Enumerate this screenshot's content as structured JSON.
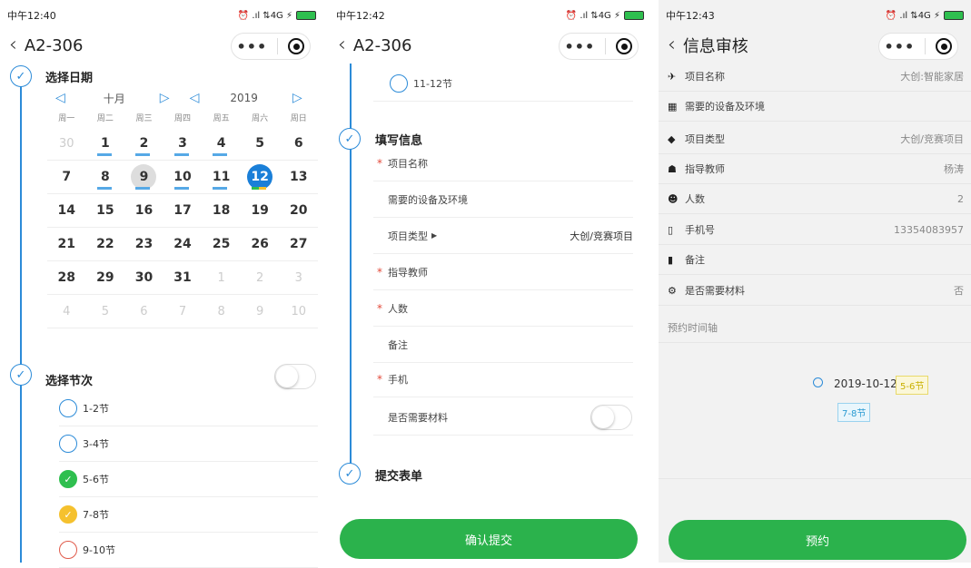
{
  "status": [
    {
      "time": "中午12:40",
      "right": "⏰ .ıl ⇅4G ⚡"
    },
    {
      "time": "中午12:42",
      "right": "⏰ .ıl ⇅4G ⚡"
    },
    {
      "time": "中午12:43",
      "right": "⏰ .ıl ⇅4G ⚡"
    }
  ],
  "screen1": {
    "title": "A2-306",
    "step_date": "选择日期",
    "month": "十月",
    "year": "2019",
    "weekdays": [
      "周一",
      "周二",
      "周三",
      "周四",
      "周五",
      "周六",
      "周日"
    ],
    "weeks": [
      [
        {
          "d": "30",
          "m": true
        },
        {
          "d": "1",
          "bar": true
        },
        {
          "d": "2",
          "bar": true
        },
        {
          "d": "3",
          "bar": true
        },
        {
          "d": "4",
          "bar": true
        },
        {
          "d": "5"
        },
        {
          "d": "6"
        }
      ],
      [
        {
          "d": "7"
        },
        {
          "d": "8",
          "bar": true
        },
        {
          "d": "9",
          "today": true,
          "bar": true
        },
        {
          "d": "10",
          "bar": true
        },
        {
          "d": "11",
          "bar": true
        },
        {
          "d": "12",
          "sel": true
        },
        {
          "d": "13"
        }
      ],
      [
        {
          "d": "14"
        },
        {
          "d": "15"
        },
        {
          "d": "16"
        },
        {
          "d": "17"
        },
        {
          "d": "18"
        },
        {
          "d": "19"
        },
        {
          "d": "20"
        }
      ],
      [
        {
          "d": "21"
        },
        {
          "d": "22"
        },
        {
          "d": "23"
        },
        {
          "d": "24"
        },
        {
          "d": "25"
        },
        {
          "d": "26"
        },
        {
          "d": "27"
        }
      ],
      [
        {
          "d": "28"
        },
        {
          "d": "29"
        },
        {
          "d": "30"
        },
        {
          "d": "31"
        },
        {
          "d": "1",
          "m": true
        },
        {
          "d": "2",
          "m": true
        },
        {
          "d": "3",
          "m": true
        }
      ],
      [
        {
          "d": "4",
          "m": true
        },
        {
          "d": "5",
          "m": true
        },
        {
          "d": "6",
          "m": true
        },
        {
          "d": "7",
          "m": true
        },
        {
          "d": "8",
          "m": true
        },
        {
          "d": "9",
          "m": true
        },
        {
          "d": "10",
          "m": true
        }
      ]
    ],
    "step_slot": "选择节次",
    "slots": [
      "1-2节",
      "3-4节",
      "5-6节",
      "7-8节",
      "9-10节"
    ]
  },
  "screen2": {
    "title": "A2-306",
    "slot_top": "11-12节",
    "step_fill": "填写信息",
    "project_name": "项目名称",
    "equipment": "需要的设备及环境",
    "project_type": "项目类型",
    "project_type_value": "大创/竞赛项目",
    "advisor": "指导教师",
    "people": "人数",
    "remark": "备注",
    "phone": "手机",
    "need_material": "是否需要材料",
    "step_submit": "提交表单",
    "submit_button": "确认提交"
  },
  "screen3": {
    "title": "信息审核",
    "rows": [
      {
        "label": "项目名称",
        "value": "大创:智能家居",
        "icon": "✈"
      },
      {
        "label": "需要的设备及环境",
        "value": "",
        "icon": "▦"
      },
      {
        "label": "项目类型",
        "value": "大创/竞赛项目",
        "icon": "◆"
      },
      {
        "label": "指导教师",
        "value": "杨涛",
        "icon": "☗"
      },
      {
        "label": "人数",
        "value": "2",
        "icon": "☻"
      },
      {
        "label": "手机号",
        "value": "13354083957",
        "icon": "▯"
      },
      {
        "label": "备注",
        "value": "",
        "icon": "▮"
      },
      {
        "label": "是否需要材料",
        "value": "否",
        "icon": "⚙"
      }
    ],
    "timeline_label": "预约时间轴",
    "timeline_date": "2019-10-12",
    "tag1": "5-6节",
    "tag2": "7-8节",
    "book_button": "预约"
  },
  "colors": {
    "accent": "#2c8bd8",
    "green": "#2bb24c",
    "yellow": "#f5c12e",
    "red": "#e05b4b"
  }
}
